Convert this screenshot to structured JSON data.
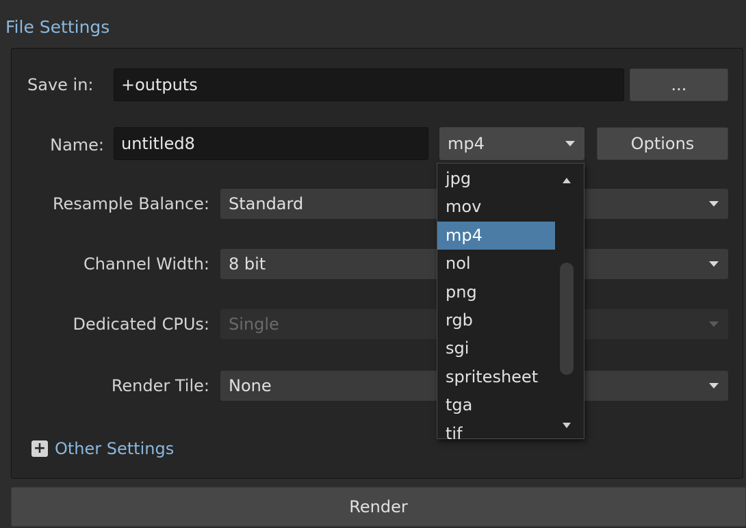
{
  "section": {
    "title": "File Settings"
  },
  "save_in": {
    "label": "Save in:",
    "value": "+outputs",
    "browse_label": "..."
  },
  "name": {
    "label": "Name:",
    "value": "untitled8",
    "format": "mp4",
    "options_label": "Options"
  },
  "resample_balance": {
    "label": "Resample Balance:",
    "value": "Standard"
  },
  "channel_width": {
    "label": "Channel Width:",
    "value": "8 bit"
  },
  "dedicated_cpus": {
    "label": "Dedicated CPUs:",
    "value": "Single"
  },
  "render_tile": {
    "label": "Render Tile:",
    "value": "None"
  },
  "format_dropdown": {
    "items": [
      "jpg",
      "mov",
      "mp4",
      "nol",
      "png",
      "rgb",
      "sgi",
      "spritesheet",
      "tga",
      "tif"
    ],
    "selected_index": 2
  },
  "other_settings": {
    "toggle": "+",
    "label": "Other Settings"
  },
  "render": {
    "label": "Render"
  },
  "colors": {
    "accent": "#8ab8df",
    "selection": "#4a7ca5",
    "panel": "#262626",
    "background": "#2d2d2d"
  }
}
